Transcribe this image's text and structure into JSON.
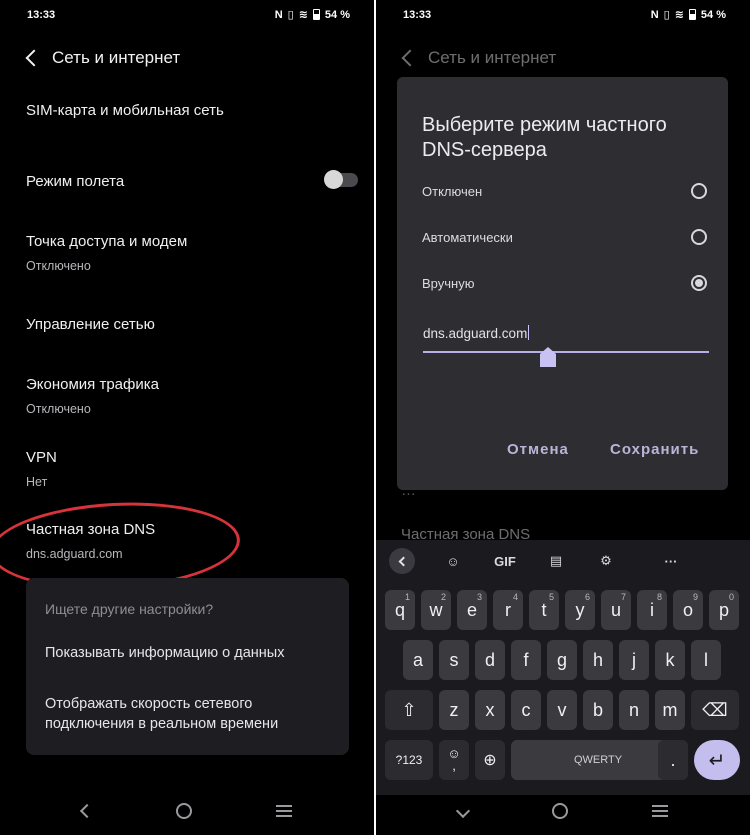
{
  "status": {
    "time": "13:33",
    "battery": "54 %"
  },
  "left": {
    "header_title": "Сеть и интернет",
    "items": [
      {
        "title": "SIM-карта и мобильная сеть",
        "subtitle": ""
      },
      {
        "title": "Режим полета",
        "subtitle": ""
      },
      {
        "title": "Точка доступа и модем",
        "subtitle": "Отключено"
      },
      {
        "title": "Управление сетью",
        "subtitle": ""
      },
      {
        "title": "Экономия трафика",
        "subtitle": "Отключено"
      },
      {
        "title": "VPN",
        "subtitle": "Нет"
      },
      {
        "title": "Частная зона DNS",
        "subtitle": "dns.adguard.com"
      }
    ],
    "airplane_toggle_on": false,
    "suggestions": {
      "question": "Ищете другие настройки?",
      "item1": "Показывать информацию о данных",
      "item2": "Отображать скорость сетевого подключения в реальном времени"
    }
  },
  "right": {
    "header_title": "Сеть и интернет",
    "dialog": {
      "title": "Выберите режим частного DNS-сервера",
      "options": [
        {
          "label": "Отключен",
          "selected": false
        },
        {
          "label": "Автоматически",
          "selected": false
        },
        {
          "label": "Вручную",
          "selected": true
        }
      ],
      "input_value": "dns.adguard.com",
      "cancel_label": "Отмена",
      "save_label": "Сохранить"
    },
    "behind_item": "Частная зона DNS",
    "keyboard": {
      "toolbar": {
        "gif": "GIF",
        "more": "···"
      },
      "row1": [
        "q",
        "w",
        "e",
        "r",
        "t",
        "y",
        "u",
        "i",
        "o",
        "p"
      ],
      "row1_nums": [
        "1",
        "2",
        "3",
        "4",
        "5",
        "6",
        "7",
        "8",
        "9",
        "0"
      ],
      "row2": [
        "a",
        "s",
        "d",
        "f",
        "g",
        "h",
        "j",
        "k",
        "l"
      ],
      "row3": [
        "z",
        "x",
        "c",
        "v",
        "b",
        "n",
        "m"
      ],
      "sym_label": "?123",
      "comma": ",",
      "space_label": "QWERTY",
      "period": "."
    }
  }
}
